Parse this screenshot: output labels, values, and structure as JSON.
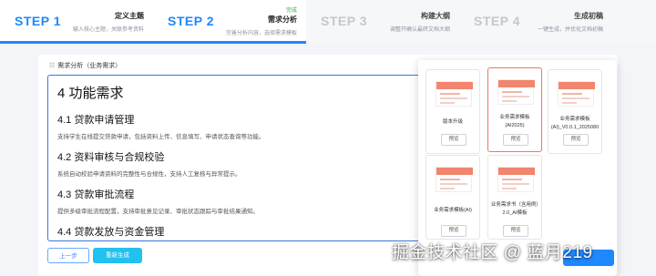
{
  "steps": [
    {
      "num": "STEP 1",
      "title": "定义主题",
      "desc": "输入核心主题，关联参考资料",
      "status": ""
    },
    {
      "num": "STEP 2",
      "title": "需求分析",
      "desc": "完善分析内容，选择需求模板",
      "status": "完成"
    },
    {
      "num": "STEP 3",
      "title": "构建大纲",
      "desc": "调整开确认最终文档大纲",
      "status": ""
    },
    {
      "num": "STEP 4",
      "title": "生成初稿",
      "desc": "一键生成，并优化文档初稿",
      "status": ""
    }
  ],
  "section": {
    "icon": "list-icon",
    "label": "需求分析（业务需求）"
  },
  "editor": {
    "h1": "4 功能需求",
    "items": [
      {
        "heading": "4.1 贷款申请管理",
        "text": "支持学生在线提交贷款申请，包括资料上传、信息填写、申请状态查询等功能。"
      },
      {
        "heading": "4.2 资料审核与合规校验",
        "text": "系统自动校验申请资料的完整性与合规性，支持人工复核与异常提示。"
      },
      {
        "heading": "4.3 贷款审批流程",
        "text": "提供多级审批流程配置，支持审批意见记录、审批状态跟踪与审批结果通知。"
      },
      {
        "heading": "4.4 贷款发放与资金管理",
        "text": ""
      }
    ]
  },
  "buttons": {
    "prev": "上一步",
    "regen": "重新生成"
  },
  "templates": [
    {
      "name": "版本升级",
      "preview": "预览",
      "active": false
    },
    {
      "name": "业务需求模板(AI2025)",
      "preview": "预览",
      "active": true
    },
    {
      "name": "业务需求模板(AI)_V0.0.1_2025080",
      "preview": "预览",
      "active": false
    },
    {
      "name": "业务需求模板(AI)",
      "preview": "预览",
      "active": false
    },
    {
      "name": "业务需求书（含用例）2.0_AI模板",
      "preview": "预览",
      "active": false
    }
  ],
  "watermark": "掘金技术社区 @ 蓝月219",
  "colors": {
    "accent": "#1e88ff",
    "done": "#30b04a",
    "active_template": "#f0765f",
    "regen": "#22c1f0"
  }
}
